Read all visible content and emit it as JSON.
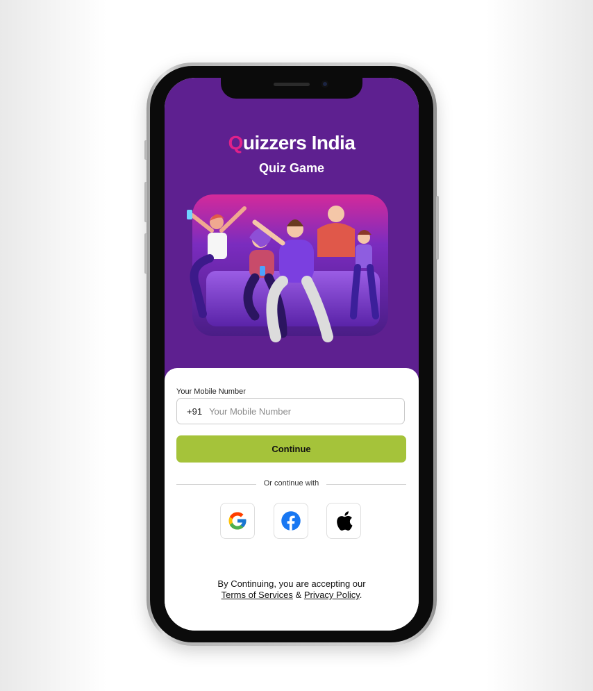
{
  "app": {
    "logo_part1": "Q",
    "logo_part2": "uizzers ",
    "logo_part3": "India",
    "subtitle": "Quiz Game"
  },
  "form": {
    "mobile_label": "Your Mobile Number",
    "country_code": "+91",
    "mobile_placeholder": "Your Mobile Number",
    "continue_label": "Continue",
    "divider_text": "Or continue with"
  },
  "social": {
    "google_icon": "google-icon",
    "facebook_icon": "facebook-icon",
    "apple_icon": "apple-icon"
  },
  "legal": {
    "line1": "By Continuing, you are accepting our",
    "terms_label": "Terms of Services",
    "amp": " & ",
    "privacy_label": "Privacy Policy",
    "period": "."
  },
  "colors": {
    "brand_purple": "#5e2090",
    "logo_pink": "#e0218a",
    "continue_green": "#a5c33a"
  }
}
